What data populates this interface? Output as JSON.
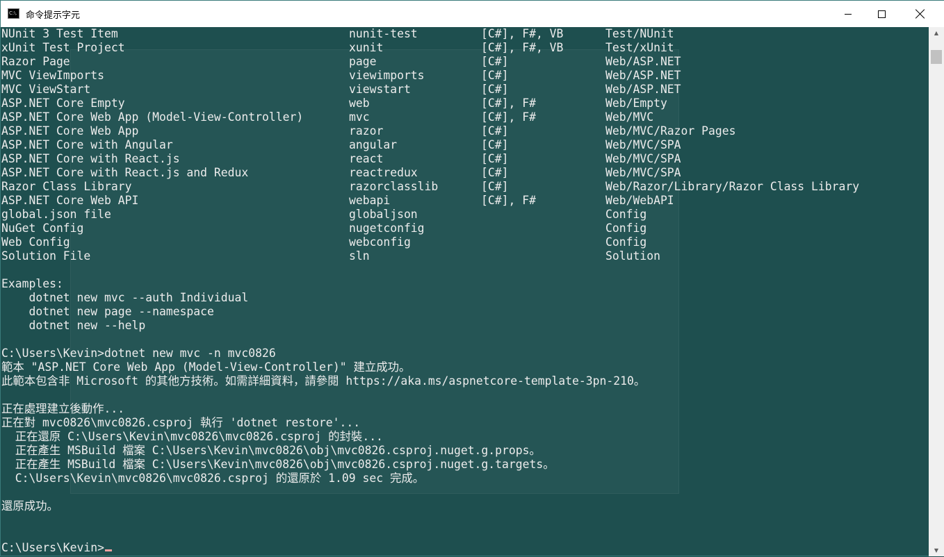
{
  "window": {
    "title": "命令提示字元",
    "icon": "cmd-icon",
    "icon_text": "C:\\.",
    "background": "#1e4f4f",
    "text_color": "#ececec"
  },
  "templates": [
    {
      "name": "NUnit 3 Test Item",
      "short": "nunit-test",
      "lang": "[C#], F#, VB",
      "tags": "Test/NUnit"
    },
    {
      "name": "xUnit Test Project",
      "short": "xunit",
      "lang": "[C#], F#, VB",
      "tags": "Test/xUnit"
    },
    {
      "name": "Razor Page",
      "short": "page",
      "lang": "[C#]",
      "tags": "Web/ASP.NET"
    },
    {
      "name": "MVC ViewImports",
      "short": "viewimports",
      "lang": "[C#]",
      "tags": "Web/ASP.NET"
    },
    {
      "name": "MVC ViewStart",
      "short": "viewstart",
      "lang": "[C#]",
      "tags": "Web/ASP.NET"
    },
    {
      "name": "ASP.NET Core Empty",
      "short": "web",
      "lang": "[C#], F#",
      "tags": "Web/Empty"
    },
    {
      "name": "ASP.NET Core Web App (Model-View-Controller)",
      "short": "mvc",
      "lang": "[C#], F#",
      "tags": "Web/MVC"
    },
    {
      "name": "ASP.NET Core Web App",
      "short": "razor",
      "lang": "[C#]",
      "tags": "Web/MVC/Razor Pages"
    },
    {
      "name": "ASP.NET Core with Angular",
      "short": "angular",
      "lang": "[C#]",
      "tags": "Web/MVC/SPA"
    },
    {
      "name": "ASP.NET Core with React.js",
      "short": "react",
      "lang": "[C#]",
      "tags": "Web/MVC/SPA"
    },
    {
      "name": "ASP.NET Core with React.js and Redux",
      "short": "reactredux",
      "lang": "[C#]",
      "tags": "Web/MVC/SPA"
    },
    {
      "name": "Razor Class Library",
      "short": "razorclasslib",
      "lang": "[C#]",
      "tags": "Web/Razor/Library/Razor Class Library"
    },
    {
      "name": "ASP.NET Core Web API",
      "short": "webapi",
      "lang": "[C#], F#",
      "tags": "Web/WebAPI"
    },
    {
      "name": "global.json file",
      "short": "globaljson",
      "lang": "",
      "tags": "Config"
    },
    {
      "name": "NuGet Config",
      "short": "nugetconfig",
      "lang": "",
      "tags": "Config"
    },
    {
      "name": "Web Config",
      "short": "webconfig",
      "lang": "",
      "tags": "Config"
    },
    {
      "name": "Solution File",
      "short": "sln",
      "lang": "",
      "tags": "Solution"
    }
  ],
  "output": [
    "",
    "Examples:",
    "    dotnet new mvc --auth Individual",
    "    dotnet new page --namespace",
    "    dotnet new --help",
    "",
    "C:\\Users\\Kevin>dotnet new mvc -n mvc0826",
    "範本 \"ASP.NET Core Web App (Model-View-Controller)\" 建立成功。",
    "此範本包含非 Microsoft 的其他方技術。如需詳細資料，請參閱 https://aka.ms/aspnetcore-template-3pn-210。",
    "",
    "正在處理建立後動作...",
    "正在對 mvc0826\\mvc0826.csproj 執行 'dotnet restore'...",
    "  正在還原 C:\\Users\\Kevin\\mvc0826\\mvc0826.csproj 的封裝...",
    "  正在產生 MSBuild 檔案 C:\\Users\\Kevin\\mvc0826\\obj\\mvc0826.csproj.nuget.g.props。",
    "  正在產生 MSBuild 檔案 C:\\Users\\Kevin\\mvc0826\\obj\\mvc0826.csproj.nuget.g.targets。",
    "  C:\\Users\\Kevin\\mvc0826\\mvc0826.csproj 的還原於 1.09 sec 完成。",
    "",
    "還原成功。",
    "",
    ""
  ],
  "prompt": "C:\\Users\\Kevin>",
  "cursor_color": "#f0a0a0"
}
